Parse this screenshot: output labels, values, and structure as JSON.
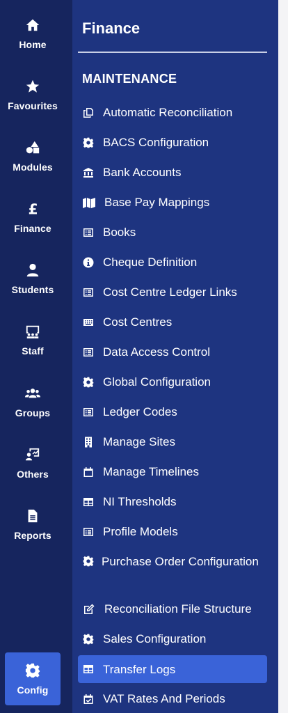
{
  "rail": {
    "items": [
      {
        "label": "Home",
        "icon": "home-icon"
      },
      {
        "label": "Favourites",
        "icon": "star-icon"
      },
      {
        "label": "Modules",
        "icon": "shapes-icon"
      },
      {
        "label": "Finance",
        "icon": "pound-icon"
      },
      {
        "label": "Students",
        "icon": "user-icon"
      },
      {
        "label": "Staff",
        "icon": "chalkboard-user-icon"
      },
      {
        "label": "Groups",
        "icon": "users-icon"
      },
      {
        "label": "Others",
        "icon": "chart-user-icon"
      },
      {
        "label": "Reports",
        "icon": "file-icon"
      },
      {
        "label": "Config",
        "icon": "gear-icon"
      }
    ],
    "active": "Config"
  },
  "panel": {
    "title": "Finance",
    "section": "MAINTENANCE",
    "items": [
      {
        "label": "Automatic Reconciliation",
        "icon": "copy-icon"
      },
      {
        "label": "BACS Configuration",
        "icon": "gear-icon"
      },
      {
        "label": "Bank Accounts",
        "icon": "bank-icon"
      },
      {
        "label": "Base Pay Mappings",
        "icon": "map-icon"
      },
      {
        "label": "Books",
        "icon": "list-icon"
      },
      {
        "label": "Cheque Definition",
        "icon": "info-icon"
      },
      {
        "label": "Cost Centre Ledger Links",
        "icon": "list-icon"
      },
      {
        "label": "Cost Centres",
        "icon": "keyboard-icon"
      },
      {
        "label": "Data Access Control",
        "icon": "list-icon"
      },
      {
        "label": "Global Configuration",
        "icon": "gear-icon"
      },
      {
        "label": "Ledger Codes",
        "icon": "list-icon"
      },
      {
        "label": "Manage Sites",
        "icon": "building-icon"
      },
      {
        "label": "Manage Timelines",
        "icon": "calendar-icon"
      },
      {
        "label": "NI Thresholds",
        "icon": "table-icon"
      },
      {
        "label": "Profile Models",
        "icon": "list-icon"
      },
      {
        "label": "Purchase Order Configuration",
        "icon": "gear-icon"
      },
      {
        "label": "Reconciliation File Structure",
        "icon": "edit-icon"
      },
      {
        "label": "Sales Configuration",
        "icon": "gear-icon"
      },
      {
        "label": "Transfer Logs",
        "icon": "table-icon"
      },
      {
        "label": "VAT Rates And Periods",
        "icon": "calendar-check-icon"
      }
    ],
    "active": "Transfer Logs"
  },
  "colors": {
    "rail_bg": "#16255e",
    "panel_bg": "#1e3480",
    "accent": "#3a63d8"
  }
}
